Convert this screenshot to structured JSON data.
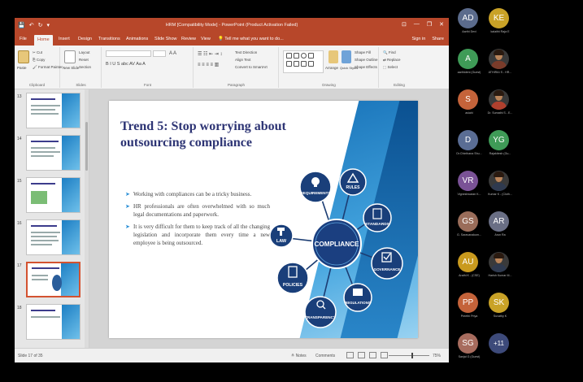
{
  "window": {
    "title": "HRM [Compatibility Mode] - PowerPoint (Product Activation Failed)",
    "quick_access": [
      "💾",
      "↶",
      "↻",
      "▾"
    ],
    "controls": [
      "⊡",
      "—",
      "❐",
      "✕"
    ]
  },
  "ribbon_tabs": [
    "File",
    "Home",
    "Insert",
    "Design",
    "Transitions",
    "Animations",
    "Slide Show",
    "Review",
    "View"
  ],
  "active_tab": "Home",
  "tell_me": "💡 Tell me what you want to do...",
  "account": {
    "sign_in": "Sign in",
    "share": "Share"
  },
  "ribbon": {
    "clipboard": {
      "paste": "Paste",
      "cut": "Cut",
      "copy": "Copy",
      "format_painter": "Format Painter",
      "label": "Clipboard"
    },
    "slides": {
      "new_slide": "New Slide",
      "layout": "Layout",
      "reset": "Reset",
      "section": "Section",
      "label": "Slides"
    },
    "font": {
      "label": "Font",
      "buttons": "B  I  U  S  abc  AV  Aa  A"
    },
    "paragraph": {
      "label": "Paragraph",
      "text_direction": "Text Direction",
      "align_text": "Align Text",
      "smartart": "Convert to SmartArt"
    },
    "drawing": {
      "label": "Drawing",
      "arrange": "Arrange",
      "quick_styles": "Quick Styles",
      "shape_fill": "Shape Fill",
      "shape_outline": "Shape Outline",
      "shape_effects": "Shape Effects"
    },
    "editing": {
      "label": "Editing",
      "find": "Find",
      "replace": "Replace",
      "select": "Select"
    }
  },
  "thumbnails": [
    {
      "num": "13"
    },
    {
      "num": "14"
    },
    {
      "num": "15"
    },
    {
      "num": "16"
    },
    {
      "num": "17"
    },
    {
      "num": "18"
    }
  ],
  "selected_slide": 17,
  "slide": {
    "title": "Trend 5: Stop worrying about outsourcing compliance",
    "bullets": [
      "Working with compliances can be a tricky business.",
      "HR professionals are often overwhelmed with so much legal documentations and paperwork.",
      "It is very difficult for them to keep track of all the changing legislation and incorporate them every time a new employee is being outsourced."
    ],
    "diagram": {
      "center": "COMPLIANCE",
      "nodes": [
        "REQUIREMENTS",
        "RULES",
        "STANDARDS",
        "GOVERNANCE",
        "REGULATIONS",
        "TRANSPARENCY",
        "POLICIES",
        "LAW"
      ]
    }
  },
  "status": {
    "slide_of": "Slide 17 of 35",
    "notes": "≙ Notes",
    "comments": "Comments",
    "zoom": "75%"
  },
  "participants": [
    {
      "initials": "AD",
      "name": "Aarthi Devi",
      "color": "#5b6b8c"
    },
    {
      "initials": "KE",
      "name": "kalaithi Raja E",
      "color": "#c9a227"
    },
    {
      "initials": "A",
      "name": "aarthideni (Guest)",
      "color": "#3f9b57"
    },
    {
      "initials": "",
      "name": "ATHIRAI S - HR...",
      "color": "#7a3b2a",
      "photo": true
    },
    {
      "initials": "S",
      "name": "asiahi",
      "color": "#c4633a"
    },
    {
      "initials": "",
      "name": "Dr. Sumathi S - E...",
      "color": "#b0402e",
      "photo": true
    },
    {
      "initials": "D",
      "name": "Dr.Chinthana Shu...",
      "color": "#5a6d94"
    },
    {
      "initials": "YG",
      "name": "Rajakitesh (Gu...",
      "color": "#3f9b57"
    },
    {
      "initials": "VR",
      "name": "Vigneshwaran K...",
      "color": "#7a5296"
    },
    {
      "initials": "",
      "name": "Kumar K - (Cloth...",
      "color": "#2f3a4f",
      "photo": true
    },
    {
      "initials": "GS",
      "name": "G. Saravanakum...",
      "color": "#9a6d5a"
    },
    {
      "initials": "AR",
      "name": "Arun Ra",
      "color": "#6a6f85"
    },
    {
      "initials": "AU",
      "name": "Arathi K - (CSE)",
      "color": "#c99a1e"
    },
    {
      "initials": "",
      "name": "Harish Kumar M...",
      "color": "#2f3a4f",
      "photo": true
    },
    {
      "initials": "PP",
      "name": "Preethi Priya",
      "color": "#c4633a"
    },
    {
      "initials": "SK",
      "name": "Suvathy K",
      "color": "#c9a227"
    },
    {
      "initials": "SG",
      "name": "Sanjai G (Guest)",
      "color": "#a76c5e"
    },
    {
      "initials": "+11",
      "name": "",
      "color": "#3d4a7a"
    }
  ]
}
